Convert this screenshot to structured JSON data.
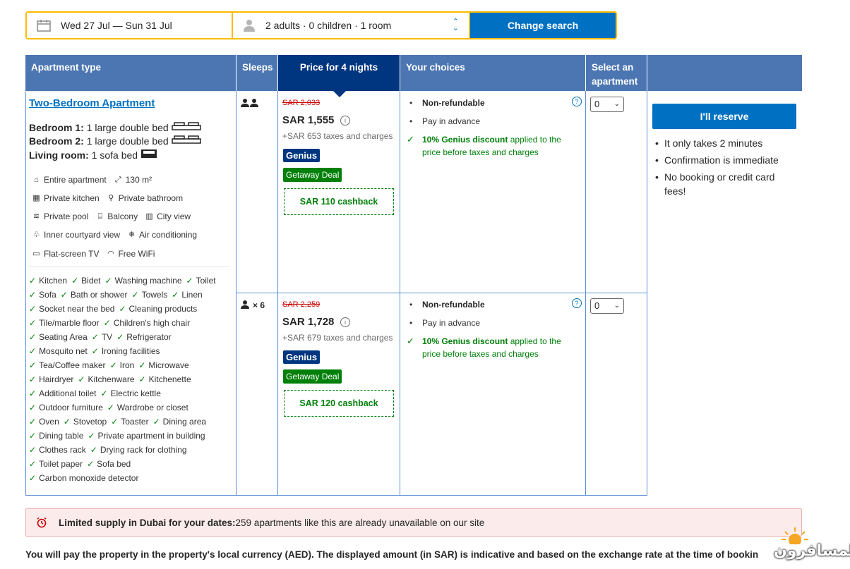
{
  "search": {
    "dates": "Wed 27 Jul — Sun 31 Jul",
    "guests": "2 adults · 0 children · 1 room",
    "change_label": "Change search"
  },
  "table": {
    "headers": [
      "Apartment type",
      "Sleeps",
      "Price for 4 nights",
      "Your choices",
      "Select an apartment"
    ],
    "room": {
      "name": "Two-Bedroom Apartment",
      "beds": [
        {
          "label": "Bedroom 1:",
          "value": "1 large double bed"
        },
        {
          "label": "Bedroom 2:",
          "value": "1 large double bed"
        },
        {
          "label": "Living room:",
          "value": "1 sofa bed"
        }
      ],
      "facilities": [
        [
          "Entire apartment",
          "130 m²"
        ],
        [
          "Private kitchen",
          "Private bathroom"
        ],
        [
          "Private pool",
          "Balcony",
          "City view"
        ],
        [
          "Inner courtyard view",
          "Air conditioning"
        ],
        [
          "Flat-screen TV",
          "Free WiFi"
        ]
      ],
      "amenities": [
        [
          "Kitchen",
          "Bidet",
          "Washing machine",
          "Toilet"
        ],
        [
          "Sofa",
          "Bath or shower",
          "Towels",
          "Linen"
        ],
        [
          "Socket near the bed",
          "Cleaning products"
        ],
        [
          "Tile/marble floor",
          "Children's high chair"
        ],
        [
          "Seating Area",
          "TV",
          "Refrigerator"
        ],
        [
          "Mosquito net",
          "Ironing facilities"
        ],
        [
          "Tea/Coffee maker",
          "Iron",
          "Microwave"
        ],
        [
          "Hairdryer",
          "Kitchenware",
          "Kitchenette"
        ],
        [
          "Additional toilet",
          "Electric kettle"
        ],
        [
          "Outdoor furniture",
          "Wardrobe or closet"
        ],
        [
          "Oven",
          "Stovetop",
          "Toaster",
          "Dining area"
        ],
        [
          "Dining table",
          "Private apartment in building"
        ],
        [
          "Clothes rack",
          "Drying rack for clothing"
        ],
        [
          "Toilet paper",
          "Sofa bed"
        ],
        [
          "Carbon monoxide detector"
        ]
      ]
    },
    "options": [
      {
        "sleeps": "",
        "old_price": "SAR 2,033",
        "price": "SAR 1,555",
        "taxes": "+SAR 653 taxes and charges",
        "genius": "Genius",
        "deal": "Getaway Deal",
        "cashback": "SAR 110 cashback",
        "choice1": "Non-refundable",
        "choice2": "Pay in advance",
        "discount_bold": "10% Genius discount",
        "discount_rest": " applied to the price before taxes and charges",
        "select_value": "0"
      },
      {
        "sleeps": "× 6",
        "old_price": "SAR 2,259",
        "price": "SAR 1,728",
        "taxes": "+SAR 679 taxes and charges",
        "genius": "Genius",
        "deal": "Getaway Deal",
        "cashback": "SAR 120 cashback",
        "choice1": "Non-refundable",
        "choice2": "Pay in advance",
        "discount_bold": "10% Genius discount",
        "discount_rest": " applied to the price before taxes and charges",
        "select_value": "0"
      }
    ]
  },
  "reserve": {
    "button": "I'll reserve",
    "perks": [
      "It only takes 2 minutes",
      "Confirmation is immediate",
      "No booking or credit card fees!"
    ]
  },
  "alert": {
    "bold": "Limited supply in Dubai for your dates:",
    "text": " 259 apartments like this are already unavailable on our site"
  },
  "footer_note": "You will pay the property in the property's local currency (AED). The displayed amount (in SAR) is indicative and based on the exchange rate at the time of bookin",
  "watermark": "المسافرون"
}
